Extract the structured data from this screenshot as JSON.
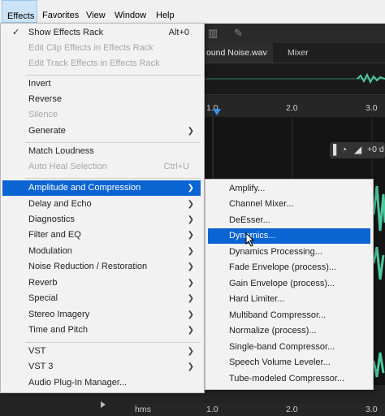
{
  "menubar": [
    "Effects",
    "Favorites",
    "View",
    "Window",
    "Help"
  ],
  "tabs": {
    "file_tab": "ound Noise.wav",
    "mixer_tab": "Mixer"
  },
  "ruler_top": [
    "1.0",
    "2.0",
    "3.0"
  ],
  "ruler_bottom": {
    "unit": "hms",
    "ticks": [
      "1.0",
      "2.0",
      "3.0"
    ]
  },
  "hud": {
    "value": "+0 d"
  },
  "effects_menu": {
    "show_effects_rack": {
      "label": "Show Effects Rack",
      "shortcut": "Alt+0",
      "checked": true
    },
    "edit_clip_effects": "Edit Clip Effects in Effects Rack",
    "edit_track_effects": "Edit Track Effects in Effects Rack",
    "invert": "Invert",
    "reverse": "Reverse",
    "silence": "Silence",
    "generate": "Generate",
    "match_loudness": "Match Loudness",
    "auto_heal": {
      "label": "Auto Heal Selection",
      "shortcut": "Ctrl+U"
    },
    "categories": [
      "Amplitude and Compression",
      "Delay and Echo",
      "Diagnostics",
      "Filter and EQ",
      "Modulation",
      "Noise Reduction / Restoration",
      "Reverb",
      "Special",
      "Stereo Imagery",
      "Time and Pitch"
    ],
    "vst": "VST",
    "vst3": "VST 3",
    "plugin_manager": "Audio Plug-In Manager..."
  },
  "submenu": [
    "Amplify...",
    "Channel Mixer...",
    "DeEsser...",
    "Dynamics...",
    "Dynamics Processing...",
    "Fade Envelope (process)...",
    "Gain Envelope (process)...",
    "Hard Limiter...",
    "Multiband Compressor...",
    "Normalize (process)...",
    "Single-band Compressor...",
    "Speech Volume Leveler...",
    "Tube-modeled Compressor..."
  ],
  "colors": {
    "highlight": "#0a64d2",
    "playhead": "#3b8fe6",
    "waveform": "#4fc9a0"
  }
}
